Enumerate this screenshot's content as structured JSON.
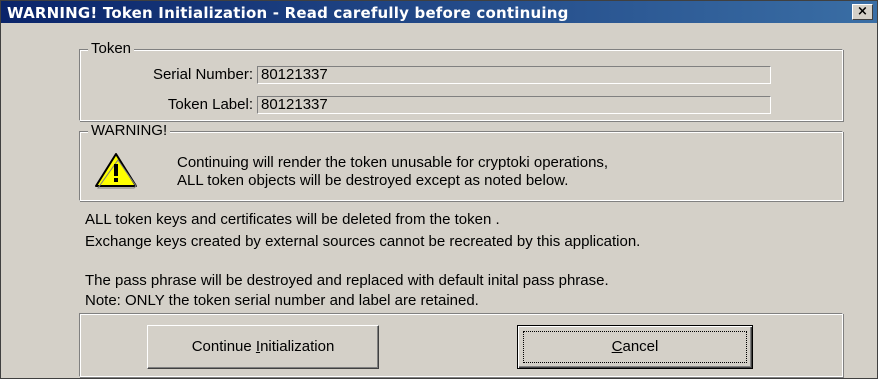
{
  "window": {
    "title": "WARNING!  Token Initialization  - Read carefully before continuing",
    "close_glyph": "×"
  },
  "token_group": {
    "legend": "Token",
    "serial_label": "Serial Number:",
    "serial_value": "80121337",
    "label_label": "Token Label:",
    "label_value": "80121337"
  },
  "warning_group": {
    "legend": "WARNING!",
    "icon": "warning-icon",
    "line1": "Continuing will render the token unusable for cryptoki operations,",
    "line2": "ALL token objects will be destroyed except as noted below."
  },
  "info": [
    "ALL token keys and certificates will be deleted from the token .",
    "Exchange keys created by external sources cannot be recreated by this application.",
    "The pass phrase will be destroyed and replaced with default inital pass phrase.",
    "Note: ONLY the token serial number and label are retained."
  ],
  "buttons": {
    "continue_pre": "Continue ",
    "continue_hotkey": "I",
    "continue_post": "nitialization",
    "cancel_hotkey": "C",
    "cancel_post": "ancel"
  },
  "colors": {
    "title_bar_start": "#0a246a",
    "title_bar_end": "#3a6ea5",
    "face": "#d4d0c8",
    "warning_yellow": "#ffff00"
  }
}
